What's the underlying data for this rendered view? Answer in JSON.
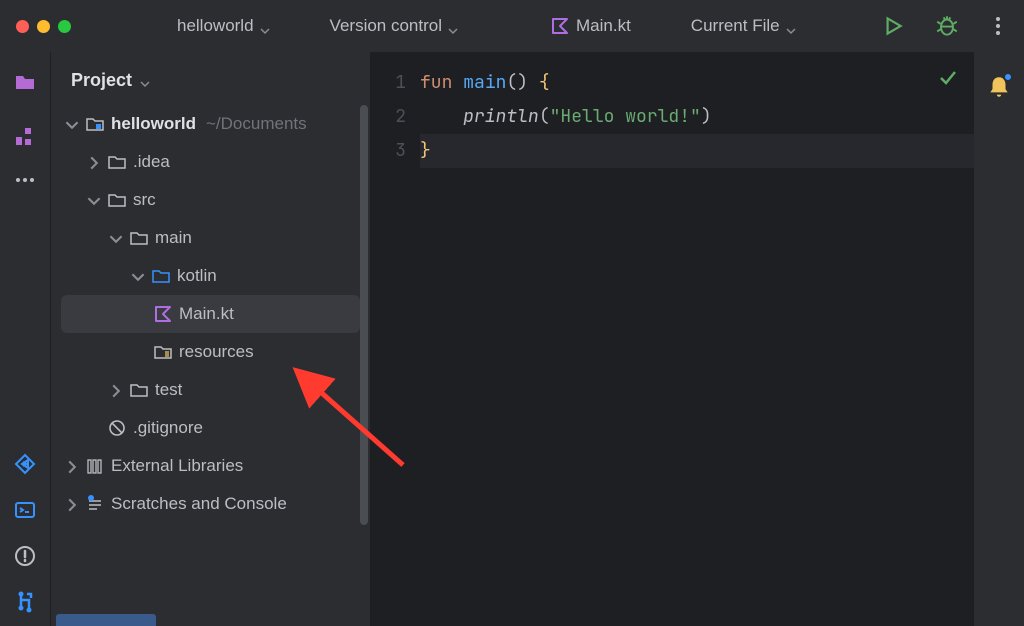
{
  "toolbar": {
    "project_name": "helloworld",
    "version_control": "Version control",
    "current_tab": "Main.kt",
    "run_config": "Current File"
  },
  "sidebar": {
    "title": "Project",
    "root": {
      "name": "helloworld",
      "path": "~/Documents"
    },
    "items": {
      "idea": ".idea",
      "src": "src",
      "main": "main",
      "kotlin": "kotlin",
      "mainkt": "Main.kt",
      "resources": "resources",
      "test": "test",
      "gitignore": ".gitignore",
      "extlib": "External Libraries",
      "scratches": "Scratches and Console"
    }
  },
  "editor": {
    "lines": [
      "1",
      "2",
      "3"
    ],
    "code": {
      "l1_fun": "fun",
      "l1_main": "main",
      "l1_parens": "()",
      "l1_brace": "{",
      "l2_indent": "    ",
      "l2_println": "println",
      "l2_open": "(",
      "l2_str": "\"Hello world!\"",
      "l2_close": ")",
      "l3_brace": "}"
    }
  }
}
